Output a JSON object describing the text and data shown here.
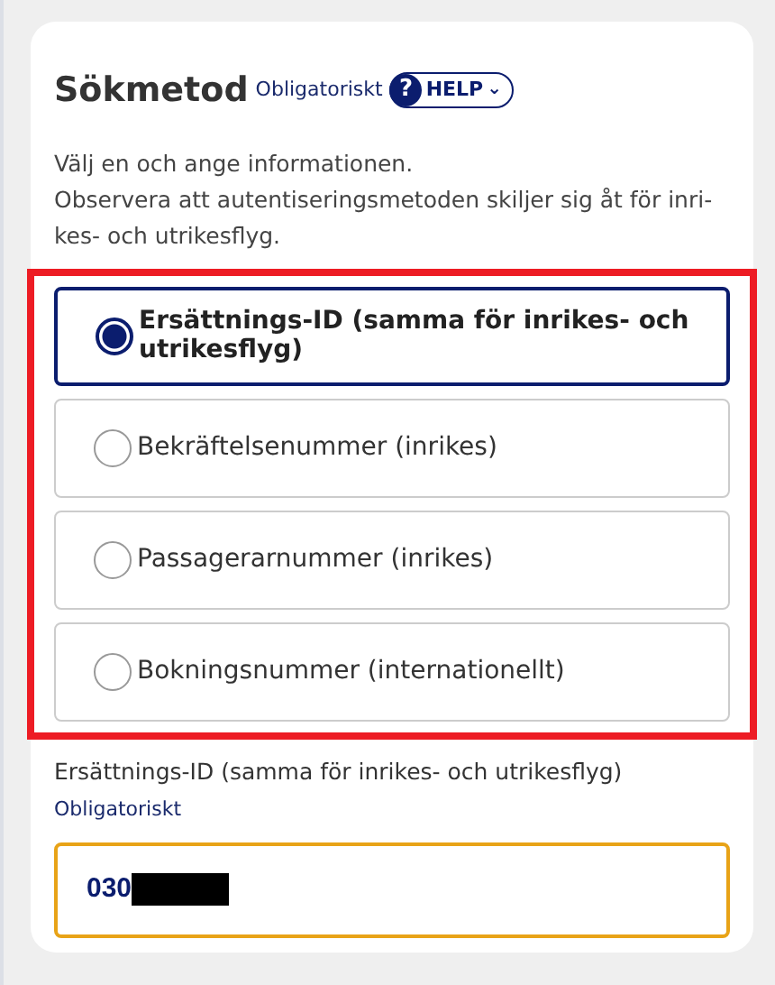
{
  "section": {
    "title": "Sökmetod",
    "required_label": "Obligatoriskt",
    "help_button": {
      "icon_text": "?",
      "label": "HELP",
      "caret": "⌄"
    },
    "description": [
      "Välj en och ange informationen.",
      "Observera att autentiseringsmetoden skiljer sig åt för inri-kes- och utrikesflyg."
    ]
  },
  "options_highlighted": true,
  "options": [
    {
      "label": "Ersättnings-ID (samma för inrikes- och utrikesflyg)",
      "selected": true
    },
    {
      "label": "Bekräftelsenummer (inrikes)",
      "selected": false
    },
    {
      "label": "Passagerarnummer (inrikes)",
      "selected": false
    },
    {
      "label": "Bokningsnummer (internationellt)",
      "selected": false
    }
  ],
  "field": {
    "label": "Ersättnings-ID (samma för inrikes- och utrikesflyg)",
    "required_label": "Obligatoriskt",
    "value": "030",
    "redacted": true,
    "focused": true
  }
}
